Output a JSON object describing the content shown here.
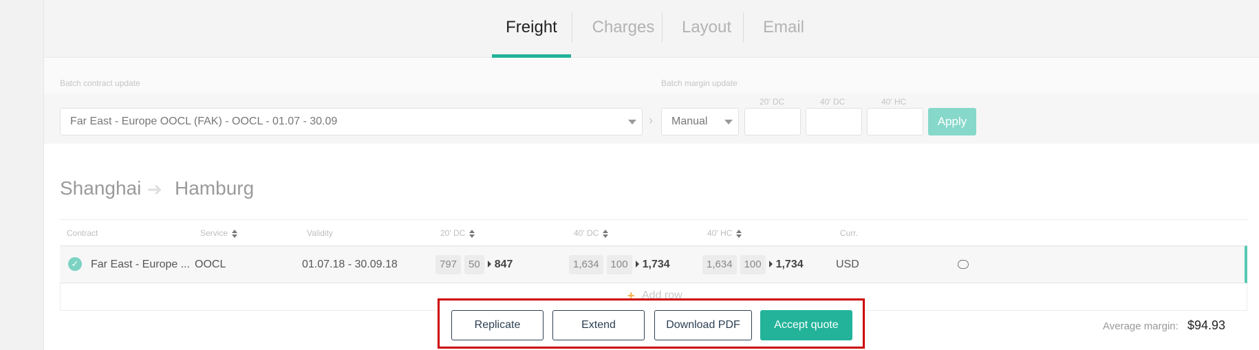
{
  "tabs": [
    {
      "label": "Freight",
      "active": true
    },
    {
      "label": "Charges",
      "active": false
    },
    {
      "label": "Layout",
      "active": false
    },
    {
      "label": "Email",
      "active": false
    }
  ],
  "batch": {
    "contract_label": "Batch contract update",
    "contract_value": "Far East - Europe OOCL (FAK) - OOCL - 01.07 - 30.09",
    "margin_label": "Batch margin update",
    "margin_mode": "Manual",
    "col_20dc": "20' DC",
    "col_40dc": "40' DC",
    "col_40hc": "40' HC",
    "apply_label": "Apply"
  },
  "route": {
    "origin": "Shanghai",
    "destination": "Hamburg"
  },
  "table": {
    "headers": {
      "contract": "Contract",
      "service": "Service",
      "validity": "Validity",
      "dc20": "20' DC",
      "dc40": "40' DC",
      "hc40": "40' HC",
      "curr": "Curr."
    },
    "rows": [
      {
        "contract": "Far East - Europe ...",
        "service": "OOCL",
        "validity": "01.07.18 - 30.09.18",
        "dc20": {
          "base": "797",
          "margin": "50",
          "total": "847"
        },
        "dc40": {
          "base": "1,634",
          "margin": "100",
          "total": "1,734"
        },
        "hc40": {
          "base": "1,634",
          "margin": "100",
          "total": "1,734"
        },
        "currency": "USD"
      }
    ],
    "add_row_label": "Add row"
  },
  "actions": {
    "replicate": "Replicate",
    "extend": "Extend",
    "download_pdf": "Download PDF",
    "accept_quote": "Accept quote"
  },
  "summary": {
    "avg_margin_label": "Average margin:",
    "avg_margin_value": "$94.93"
  },
  "colors": {
    "accent": "#22b39a",
    "highlight_box": "#cc0000"
  }
}
